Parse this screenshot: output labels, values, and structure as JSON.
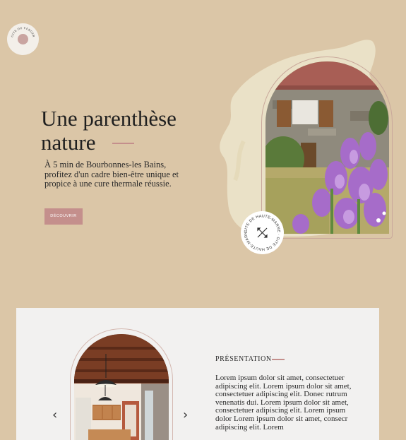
{
  "logo": {
    "text": "GITE DU VERGER",
    "icon": "leaf-emblem-icon"
  },
  "hero": {
    "title_line1": "Une parenthèse",
    "title_line2": "nature",
    "description": "À 5 min de Bourbonnes-les Bains, profitez d'un cadre bien-être unique et propice à une cure thermale réussie.",
    "button_label": "DÉCOUVRIR"
  },
  "badge": {
    "text": "GITE DE HAUTE-MARNE · GITE DE HAUTE-MARNE ·",
    "icon": "crossed-arrows-icon"
  },
  "presentation": {
    "label": "PRÉSENTATION",
    "body": "Lorem ipsum dolor sit amet, consectetuer adipiscing elit. Lorem ipsum dolor sit amet, consectetuer adipiscing elit. Donec rutrum venenatis dui. Lorem ipsum dolor sit amet, consectetuer adipiscing elit. Lorem ipsum dolor  Lorem ipsum dolor sit amet, consecr adipiscing elit. Lorem",
    "prev_icon": "chevron-left-icon",
    "next_icon": "chevron-right-icon"
  },
  "colors": {
    "background": "#dbc6a7",
    "accent": "#c48f8c",
    "card": "#f2f1f0",
    "blob": "#ebe3c8"
  }
}
